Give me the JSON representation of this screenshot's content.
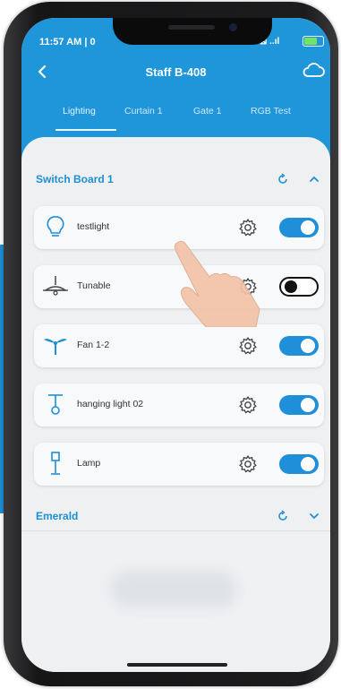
{
  "status_bar": {
    "time": "11:57 AM | 0",
    "right": "⊠ ..ıl"
  },
  "header": {
    "title": "Staff B-408",
    "back_icon": "chevron-left-icon",
    "cloud_icon": "cloud-icon"
  },
  "tabs": [
    {
      "label": "Lighting",
      "active": true
    },
    {
      "label": "Curtain 1",
      "active": false
    },
    {
      "label": "Gate 1",
      "active": false
    },
    {
      "label": "RGB Test",
      "active": false
    }
  ],
  "sections": [
    {
      "title": "Switch Board 1",
      "refresh_icon": "refresh-icon",
      "toggle_icon": "chevron-up-icon"
    },
    {
      "title": "Emerald",
      "refresh_icon": "refresh-icon",
      "toggle_icon": "chevron-down-icon"
    }
  ],
  "devices": [
    {
      "name": "testlight",
      "icon": "bulb-icon",
      "on": true
    },
    {
      "name": "Tunable",
      "icon": "ceiling-lamp-icon",
      "on": false
    },
    {
      "name": "Fan 1-2",
      "icon": "fan-icon",
      "on": true
    },
    {
      "name": "hanging light 02",
      "icon": "hanging-light-icon",
      "on": true
    },
    {
      "name": "Lamp",
      "icon": "floor-lamp-icon",
      "on": true
    }
  ],
  "colors": {
    "accent": "#1f96d9",
    "battery": "#6fe36a",
    "toggle_on": "#1f8fd9"
  }
}
